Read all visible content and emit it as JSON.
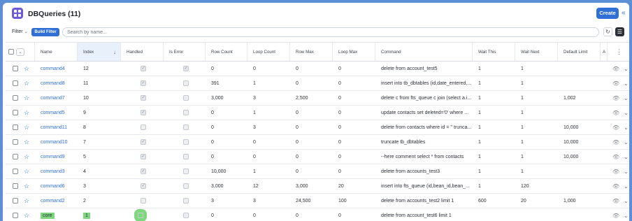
{
  "header": {
    "title": "DBQueries (11)",
    "create_label": "Create",
    "collapse_icon": "double-chevron-left-icon",
    "app_icon": "grid-icon"
  },
  "filterbar": {
    "filter_label": "Filter",
    "build_filter_label": "Build Filter",
    "search_placeholder": "Search by name...",
    "refresh_icon": "refresh-icon",
    "list_view_icon": "list-view-icon"
  },
  "table": {
    "columns": [
      "Name",
      "Index",
      "Handled",
      "Is Error",
      "Row Count",
      "Loop Count",
      "Row Max",
      "Loop Max",
      "Command",
      "Wait This",
      "Wait Next",
      "Default Limit",
      "A"
    ],
    "sorted_column": "Index",
    "rows": [
      {
        "name": "command4",
        "index": "12",
        "handled": true,
        "is_error": true,
        "row_count": "0",
        "loop_count": "0",
        "row_max": "0",
        "loop_max": "0",
        "command": "delete from account_test5",
        "wait_this": "1",
        "wait_next": "1",
        "default_limit": ""
      },
      {
        "name": "command8",
        "index": "11",
        "handled": true,
        "is_error": false,
        "row_count": "391",
        "loop_count": "1",
        "row_max": "0",
        "loop_max": "0",
        "command": "insert into tb_dbtables (id,date_entered,...",
        "wait_this": "1",
        "wait_next": "1",
        "default_limit": ""
      },
      {
        "name": "command7",
        "index": "10",
        "handled": true,
        "is_error": false,
        "row_count": "3,000",
        "loop_count": "3",
        "row_max": "2,500",
        "loop_max": "0",
        "command": "delete c from fts_queue c join (select a.i...",
        "wait_this": "1",
        "wait_next": "1",
        "default_limit": "1,002"
      },
      {
        "name": "command5",
        "index": "9",
        "handled": true,
        "is_error": false,
        "row_count": "0",
        "loop_count": "1",
        "row_max": "0",
        "loop_max": "0",
        "command": "update contacts set deleted='0' where ...",
        "wait_this": "1",
        "wait_next": "1",
        "default_limit": ""
      },
      {
        "name": "command11",
        "index": "8",
        "handled": false,
        "is_error": false,
        "row_count": "0",
        "loop_count": "3",
        "row_max": "0",
        "loop_max": "0",
        "command": "delete from contacts where id = '' trunca...",
        "wait_this": "1",
        "wait_next": "1",
        "default_limit": "10,000"
      },
      {
        "name": "command10",
        "index": "7",
        "handled": true,
        "is_error": false,
        "row_count": "0",
        "loop_count": "0",
        "row_max": "0",
        "loop_max": "0",
        "command": "truncate tb_dbtables",
        "wait_this": "1",
        "wait_next": "1",
        "default_limit": "10,000"
      },
      {
        "name": "command9",
        "index": "5",
        "handled": true,
        "is_error": false,
        "row_count": "0",
        "loop_count": "0",
        "row_max": "0",
        "loop_max": "0",
        "command": "--here comment select * from contacts",
        "wait_this": "1",
        "wait_next": "1",
        "default_limit": "10,000"
      },
      {
        "name": "command3",
        "index": "4",
        "handled": true,
        "is_error": false,
        "row_count": "10,000",
        "loop_count": "1",
        "row_max": "0",
        "loop_max": "0",
        "command": "delete from accounts_test3",
        "wait_this": "1",
        "wait_next": "1",
        "default_limit": ""
      },
      {
        "name": "command6",
        "index": "3",
        "handled": true,
        "is_error": false,
        "row_count": "3,000",
        "loop_count": "12",
        "row_max": "3,000",
        "loop_max": "20",
        "command": "insert into fts_queue (id,bean_id,bean_...",
        "wait_this": "1",
        "wait_next": "120",
        "default_limit": ""
      },
      {
        "name": "command2",
        "index": "2",
        "handled": false,
        "is_error": false,
        "row_count": "3",
        "loop_count": "3",
        "row_max": "24,500",
        "loop_max": "100",
        "command": "delete from accounts_test2 limit 1",
        "wait_this": "600",
        "wait_next": "20",
        "default_limit": "1,000"
      },
      {
        "name": "core",
        "index": "1",
        "handled": false,
        "is_error": false,
        "row_count": "0",
        "loop_count": "0",
        "row_max": "0",
        "loop_max": "0",
        "command": "delete from account_test6 limit 1",
        "wait_this": "",
        "wait_next": "",
        "default_limit": "",
        "highlighted": true
      }
    ]
  },
  "colors": {
    "accent": "#2f6fd6",
    "app_icon": "#6b5bd6",
    "highlight": "#7ed67e",
    "background": "#5c8fd6"
  }
}
